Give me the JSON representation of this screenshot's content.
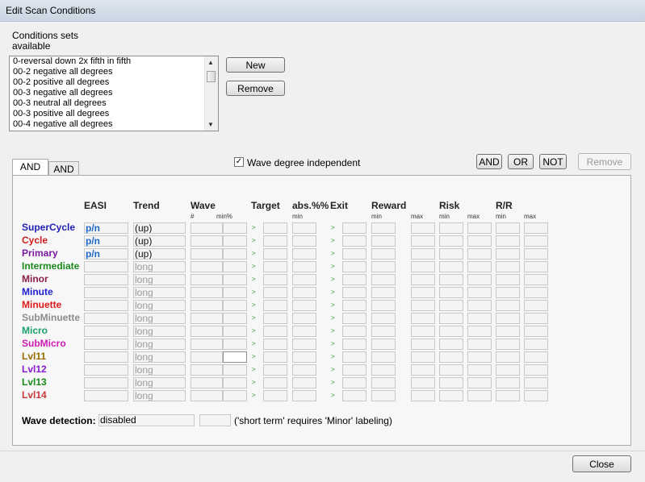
{
  "window": {
    "title": "Edit Scan Conditions"
  },
  "conditions": {
    "label_line1": "Conditions sets",
    "label_line2": "available",
    "items": [
      "0-reversal down 2x fifth in fifth",
      "00-2 negative all degrees",
      "00-2 positive all degrees",
      "00-3 negative all degrees",
      "00-3 neutral all degrees",
      "00-3 positive all degrees",
      "00-4 negative all degrees"
    ],
    "new_label": "New",
    "remove_label": "Remove"
  },
  "tabs": [
    "AND",
    "AND"
  ],
  "wave_degree_independent": {
    "label": "Wave degree independent",
    "checked": true,
    "mark": "✓"
  },
  "logic_buttons": {
    "and": "AND",
    "or": "OR",
    "not": "NOT",
    "remove": "Remove"
  },
  "columns": {
    "easi": "EASI",
    "trend": "Trend",
    "wave": "Wave",
    "target": "Target",
    "abs": "abs.%%",
    "exit": "Exit",
    "reward": "Reward",
    "risk": "Risk",
    "rr": "R/R",
    "sub_hash": "#",
    "sub_min_pct": "min%",
    "sub_min": "min",
    "sub_max": "max"
  },
  "rows": [
    {
      "name": "SuperCycle",
      "color": "#1f1fb4",
      "easi": "p/n",
      "trend": "(up)"
    },
    {
      "name": "Cycle",
      "color": "#d01d1d",
      "easi": "p/n",
      "trend": "(up)"
    },
    {
      "name": "Primary",
      "color": "#7b1aa0",
      "easi": "p/n",
      "trend": "(up)"
    },
    {
      "name": "Intermediate",
      "color": "#1d8a1d",
      "easi": "",
      "trend": "long"
    },
    {
      "name": "Minor",
      "color": "#8a1d4a",
      "easi": "",
      "trend": "long"
    },
    {
      "name": "Minute",
      "color": "#1f1fd0",
      "easi": "",
      "trend": "long"
    },
    {
      "name": "Minuette",
      "color": "#e01a1a",
      "easi": "",
      "trend": "long"
    },
    {
      "name": "SubMinuette",
      "color": "#8c8c8c",
      "easi": "",
      "trend": "long"
    },
    {
      "name": "Micro",
      "color": "#1aa06a",
      "easi": "",
      "trend": "long"
    },
    {
      "name": "SubMicro",
      "color": "#d01ab4",
      "easi": "",
      "trend": "long"
    },
    {
      "name": "Lvl11",
      "color": "#9a6a00",
      "easi": "",
      "trend": "long"
    },
    {
      "name": "Lvl12",
      "color": "#8a1ad0",
      "easi": "",
      "trend": "long"
    },
    {
      "name": "Lvl13",
      "color": "#1a8a1a",
      "easi": "",
      "trend": "long"
    },
    {
      "name": "Lvl14",
      "color": "#c83a3a",
      "easi": "",
      "trend": "long"
    }
  ],
  "arrow_glyph": ">",
  "wave_detection": {
    "label": "Wave detection:",
    "value": "disabled",
    "note": "('short term' requires 'Minor' labeling)"
  },
  "close_label": "Close"
}
